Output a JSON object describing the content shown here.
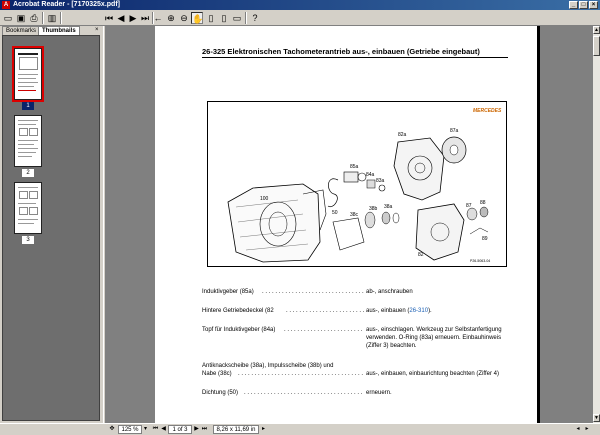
{
  "window": {
    "app_icon": "acrobat-icon",
    "title": "Acrobat Reader - [7170325x.pdf]"
  },
  "toolbar": {
    "buttons": [
      "open-icon",
      "save-icon",
      "print-icon",
      "show-navigation-icon",
      "first-page-icon",
      "previous-page-icon",
      "next-page-icon",
      "last-page-icon",
      "go-back-icon",
      "go-forward-icon",
      "zoom-in-icon",
      "zoom-out-icon",
      "hand-tool-icon",
      "actual-size-icon",
      "fit-page-icon",
      "fit-width-icon",
      "help-icon"
    ]
  },
  "sidebar": {
    "tabs": [
      "Bookmarks",
      "Thumbnails"
    ],
    "active_tab": "Thumbnails",
    "thumbnails": [
      "1",
      "2",
      "3"
    ],
    "selected": "1"
  },
  "document": {
    "heading": "26-325 Elektronischen Tachometerantrieb aus-, einbauen (Getriebe eingebaut)",
    "figure": {
      "labels": [
        "85a",
        "84a",
        "83a",
        "82a",
        "87a",
        "100",
        "50",
        "38c",
        "38b",
        "38a",
        "87",
        "88",
        "89",
        "82"
      ],
      "code": "P26-5063-04",
      "logo": "MERCEDES"
    },
    "steps": [
      {
        "part": "Induktivgeber (85a)",
        "action": "ab-, anschrauben"
      },
      {
        "part": "Hintere Getriebedeckel (82",
        "action": "aus-, einbauen (",
        "link": "26-310",
        "action_end": ")."
      },
      {
        "part": "Topf für Induktivgeber (84a)",
        "action": "aus-, einschlagen. Werkzeug zur Selbstanfertigung",
        "action2": "verwenden. O-Ring (83a) erneuern. Einbauhinweis",
        "action3": "(Ziffer 3) beachten."
      },
      {
        "part": "Antiknackscheibe (38a), Impulsscheibe (38b) und",
        "part2": "Nabe (38c)",
        "action": "aus-, einbauen, einbaurichtung beachten (Ziffer 4)"
      },
      {
        "part": "Dichtung (50)",
        "action": "erneuern."
      }
    ]
  },
  "statusbar": {
    "zoom": "125 %",
    "page_info": "1 of 3",
    "page_size": "8,26 x 11,69 in"
  }
}
